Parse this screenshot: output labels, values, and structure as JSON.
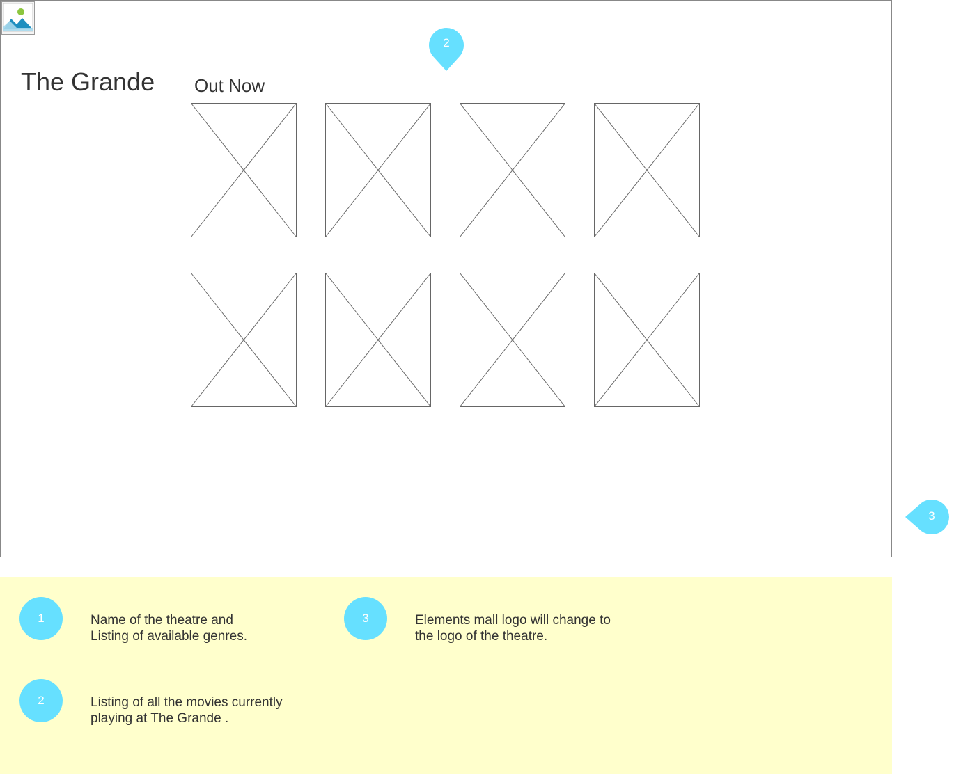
{
  "header": {
    "logo_icon": "image-placeholder-icon",
    "theatre_name": "The Grande"
  },
  "main": {
    "section_title": "Out Now",
    "posters": [
      {
        "icon": "image-placeholder-icon"
      },
      {
        "icon": "image-placeholder-icon"
      },
      {
        "icon": "image-placeholder-icon"
      },
      {
        "icon": "image-placeholder-icon"
      },
      {
        "icon": "image-placeholder-icon"
      },
      {
        "icon": "image-placeholder-icon"
      },
      {
        "icon": "image-placeholder-icon"
      },
      {
        "icon": "image-placeholder-icon"
      }
    ]
  },
  "markers": {
    "movies_marker": "2",
    "logo_marker": "3"
  },
  "notes": [
    {
      "number": "1",
      "text": "Name of the theatre and\nListing of available genres."
    },
    {
      "number": "2",
      "text": "Listing of all the movies currently\nplaying at The Grande ."
    },
    {
      "number": "3",
      "text": "Elements mall logo will change to\nthe logo of the theatre."
    }
  ],
  "colors": {
    "marker": "#66e0ff",
    "notes_background": "#ffffcc",
    "wireframe_border": "#888888",
    "text": "#333333"
  }
}
